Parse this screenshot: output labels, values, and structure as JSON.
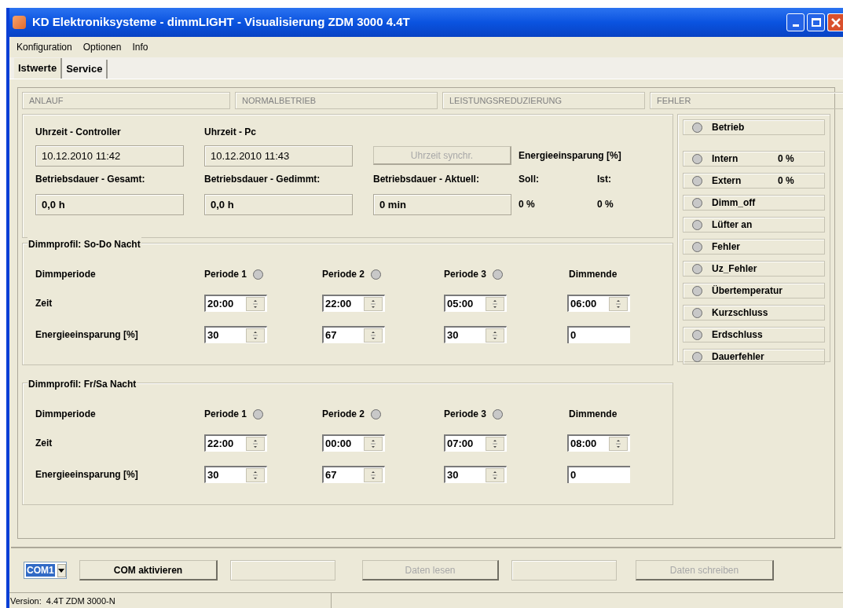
{
  "window": {
    "title": "KD Elektroniksysteme - dimmLIGHT - Visualisierung ZDM 3000 4.4T"
  },
  "menu": [
    "Konfiguration",
    "Optionen",
    "Info"
  ],
  "tabs": [
    {
      "label": "Istwerte",
      "selected": true
    },
    {
      "label": "Service",
      "selected": false
    }
  ],
  "phases": [
    "ANLAUF",
    "NORMALBETRIEB",
    "LEISTUNGSREDUZIERUNG",
    "FEHLER"
  ],
  "clock_fields": [
    {
      "label": "Uhrzeit - Controller",
      "value": "10.12.2010   11:42"
    },
    {
      "label": "Uhrzeit - Pc",
      "value": "10.12.2010   11:43"
    }
  ],
  "sync_button": {
    "label": "Uhrzeit synchr.",
    "disabled": true
  },
  "savings_title": "Energieeinsparung [%]",
  "runtime_fields": [
    {
      "label": "Betriebsdauer - Gesamt:",
      "value": "0,0 h"
    },
    {
      "label": "Betriebsdauer - Gedimmt:",
      "value": "0,0 h"
    },
    {
      "label": "Betriebsdauer - Aktuell:",
      "value": "0 min"
    }
  ],
  "savings": [
    {
      "label": "Soll:",
      "value": "0 %"
    },
    {
      "label": "Ist:",
      "value": "0 %"
    }
  ],
  "indicators": [
    {
      "label": "Betrieb",
      "on": false
    },
    {
      "label": "Intern",
      "value": "0 %",
      "on": false
    },
    {
      "label": "Extern",
      "value": "0 %",
      "on": false
    },
    {
      "label": "Dimm_off",
      "on": false
    },
    {
      "label": "Lüfter an",
      "on": false
    },
    {
      "label": "Fehler",
      "on": false
    },
    {
      "label": "Uz_Fehler",
      "on": false
    },
    {
      "label": "Übertemperatur",
      "on": false
    },
    {
      "label": "Kurzschluss",
      "on": false
    },
    {
      "label": "Erdschluss",
      "on": false
    },
    {
      "label": "Dauerfehler",
      "on": false
    }
  ],
  "profiles": [
    {
      "title": "Dimmprofil: So-Do Nacht",
      "row_header": "Dimmperiode",
      "time_label": "Zeit",
      "savings_label": "Energieeinsparung [%]",
      "periods": [
        {
          "kind": "period",
          "label": "Periode 1",
          "on": false,
          "time": "20:00",
          "savings": "30"
        },
        {
          "kind": "period",
          "label": "Periode 2",
          "on": false,
          "time": "22:00",
          "savings": "67"
        },
        {
          "kind": "period",
          "label": "Periode 3",
          "on": false,
          "time": "05:00",
          "savings": "30"
        },
        {
          "kind": "end",
          "label": "Dimmende",
          "time": "06:00",
          "savings": "0"
        }
      ]
    },
    {
      "title": "Dimmprofil: Fr/Sa Nacht",
      "row_header": "Dimmperiode",
      "time_label": "Zeit",
      "savings_label": "Energieeinsparung [%]",
      "periods": [
        {
          "kind": "period",
          "label": "Periode 1",
          "on": false,
          "time": "22:00",
          "savings": "30"
        },
        {
          "kind": "period",
          "label": "Periode 2",
          "on": false,
          "time": "00:00",
          "savings": "67"
        },
        {
          "kind": "period",
          "label": "Periode 3",
          "on": false,
          "time": "07:00",
          "savings": "30"
        },
        {
          "kind": "end",
          "label": "Dimmende",
          "time": "08:00",
          "savings": "0"
        }
      ]
    }
  ],
  "port": {
    "value": "COM1"
  },
  "activate_button": {
    "label": "COM aktivieren",
    "disabled": false
  },
  "read_button": {
    "label": "Daten lesen",
    "disabled": true
  },
  "write_button": {
    "label": "Daten schreiben",
    "disabled": true
  },
  "status_bar": "Version:  4.4T ZDM 3000-N"
}
